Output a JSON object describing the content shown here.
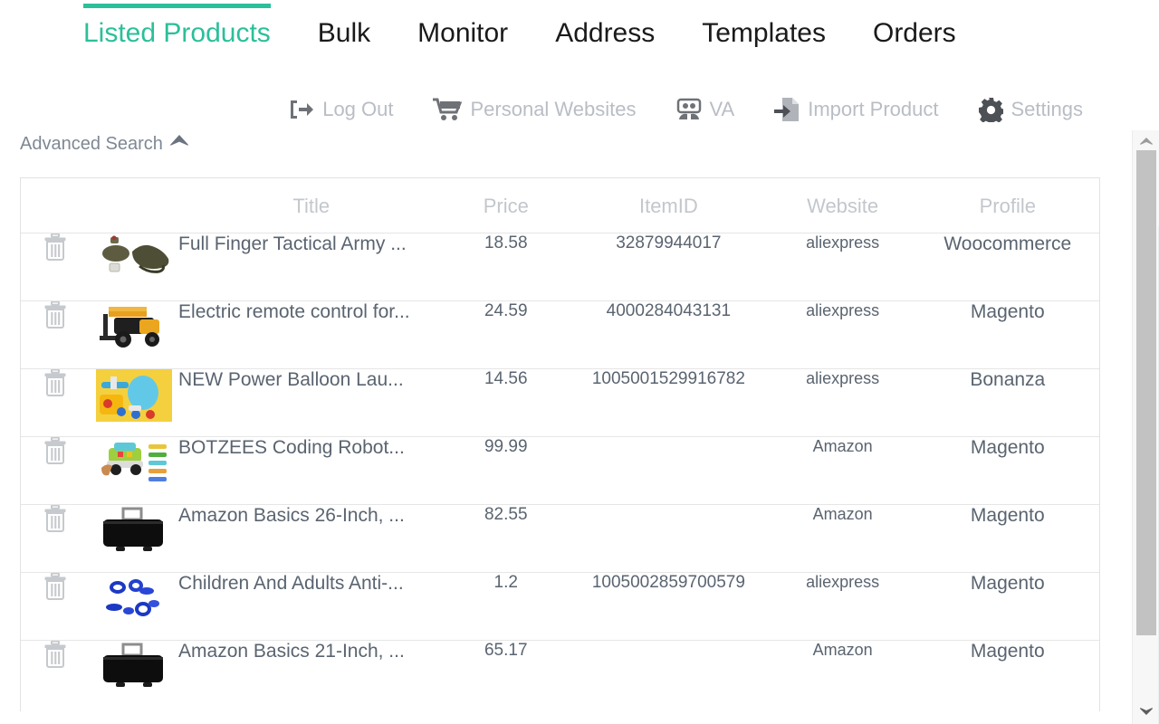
{
  "nav": {
    "accent_color": "#2bbf9a",
    "tabs": [
      {
        "label": "Listed Products",
        "active": true
      },
      {
        "label": "Bulk",
        "active": false
      },
      {
        "label": "Monitor",
        "active": false
      },
      {
        "label": "Address",
        "active": false
      },
      {
        "label": "Templates",
        "active": false
      },
      {
        "label": "Orders",
        "active": false
      }
    ]
  },
  "actions": [
    {
      "label": "Log Out",
      "icon": "logout-icon"
    },
    {
      "label": "Personal Websites",
      "icon": "cart-icon"
    },
    {
      "label": "VA",
      "icon": "users-icon"
    },
    {
      "label": "Import Product",
      "icon": "import-file-icon"
    },
    {
      "label": "Settings",
      "icon": "gear-icon"
    }
  ],
  "advanced_search": {
    "label": "Advanced Search",
    "icon": "caret-up-icon",
    "expanded": true
  },
  "table": {
    "columns": [
      "",
      "",
      "Title",
      "Price",
      "ItemID",
      "Website",
      "Profile"
    ],
    "rows": [
      {
        "delete_icon": "trash-icon",
        "thumb": "tactical-gloves",
        "title": "Full Finger Tactical Army ...",
        "price": "18.58",
        "item_id": "32879944017",
        "website": "aliexpress",
        "profile": "Woocommerce"
      },
      {
        "delete_icon": "trash-icon",
        "thumb": "forklift-toy",
        "title": "Electric remote control for...",
        "price": "24.59",
        "item_id": "4000284043131",
        "website": "aliexpress",
        "profile": "Magento"
      },
      {
        "delete_icon": "trash-icon",
        "thumb": "balloon-launcher-toy",
        "title": "NEW Power Balloon Lau...",
        "price": "14.56",
        "item_id": "1005001529916782",
        "website": "aliexpress",
        "profile": "Bonanza"
      },
      {
        "delete_icon": "trash-icon",
        "thumb": "coding-robot-toy",
        "title": "BOTZEES Coding Robot...",
        "price": "99.99",
        "item_id": "",
        "website": "Amazon",
        "profile": "Magento"
      },
      {
        "delete_icon": "trash-icon",
        "thumb": "black-suitcase",
        "title": "Amazon Basics 26-Inch, ...",
        "price": "82.55",
        "item_id": "",
        "website": "Amazon",
        "profile": "Magento"
      },
      {
        "delete_icon": "trash-icon",
        "thumb": "blue-confetti",
        "title": "Children And Adults Anti-...",
        "price": "1.2",
        "item_id": "1005002859700579",
        "website": "aliexpress",
        "profile": "Magento"
      },
      {
        "delete_icon": "trash-icon",
        "thumb": "black-suitcase",
        "title": "Amazon Basics 21-Inch, ...",
        "price": "65.17",
        "item_id": "",
        "website": "Amazon",
        "profile": "Magento"
      }
    ]
  },
  "scrollbar": {
    "up_icon": "scroll-up-arrow",
    "down_icon": "scroll-down-arrow"
  }
}
